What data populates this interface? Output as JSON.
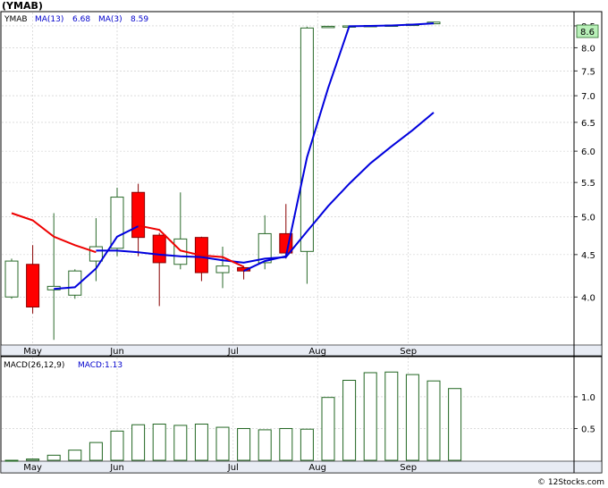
{
  "header": {
    "ticker_label": "(YMAB)",
    "legend": [
      {
        "text": "YMAB",
        "color": "#000000"
      },
      {
        "text": "MA(13)",
        "color": "#0000cc"
      },
      {
        "text": "6.68",
        "color": "#0000cc"
      },
      {
        "text": "MA(3)",
        "color": "#0000cc"
      },
      {
        "text": "8.59",
        "color": "#0000cc"
      }
    ],
    "last_price_badge": "8.6"
  },
  "footer": {
    "watermark": "© 12Stocks.com"
  },
  "colors": {
    "up_candle": "#ffffff",
    "up_border": "#2a6a2a",
    "down_candle": "#ff0000",
    "down_border": "#880000",
    "ma_fast": "#0000dd",
    "ma_slow": "#0000dd",
    "ma_red": "#ee0000",
    "axis_band": "#e8ecf4",
    "badge_bg": "#b8f0b8",
    "macd_bar": "#226622"
  },
  "chart_data": [
    {
      "type": "candlestick",
      "title": "",
      "x_ticks": [
        "May",
        "Jun",
        "Jul",
        "Aug",
        "Sep"
      ],
      "y_ticks": [
        4.0,
        4.5,
        5.0,
        5.5,
        6.0,
        6.5,
        7.0,
        7.5,
        8.0,
        8.5
      ],
      "y_scale": "log",
      "ylim": [
        3.5,
        8.8
      ],
      "candles": [
        {
          "open": 4.0,
          "high": 4.45,
          "low": 3.98,
          "close": 4.42
        },
        {
          "open": 4.38,
          "high": 4.62,
          "low": 3.82,
          "close": 3.89
        },
        {
          "open": 4.08,
          "high": 5.05,
          "low": 3.55,
          "close": 4.12
        },
        {
          "open": 4.02,
          "high": 4.32,
          "low": 3.98,
          "close": 4.3
        },
        {
          "open": 4.42,
          "high": 4.98,
          "low": 4.18,
          "close": 4.6
        },
        {
          "open": 4.58,
          "high": 5.42,
          "low": 4.48,
          "close": 5.28
        },
        {
          "open": 5.35,
          "high": 5.48,
          "low": 4.48,
          "close": 4.72
        },
        {
          "open": 4.75,
          "high": 4.78,
          "low": 3.9,
          "close": 4.4
        },
        {
          "open": 4.38,
          "high": 5.35,
          "low": 4.32,
          "close": 4.7
        },
        {
          "open": 4.72,
          "high": 4.73,
          "low": 4.18,
          "close": 4.28
        },
        {
          "open": 4.28,
          "high": 4.6,
          "low": 4.1,
          "close": 4.36
        },
        {
          "open": 4.34,
          "high": 4.36,
          "low": 4.2,
          "close": 4.3
        },
        {
          "open": 4.4,
          "high": 5.02,
          "low": 4.32,
          "close": 4.77
        },
        {
          "open": 4.77,
          "high": 5.18,
          "low": 4.45,
          "close": 4.52
        },
        {
          "open": 4.54,
          "high": 8.48,
          "low": 4.15,
          "close": 8.45
        },
        {
          "open": 8.48,
          "high": 8.5,
          "low": 8.47,
          "close": 8.49
        },
        {
          "open": 8.49,
          "high": 8.51,
          "low": 8.48,
          "close": 8.5
        },
        {
          "open": 8.5,
          "high": 8.52,
          "low": 8.49,
          "close": 8.51
        },
        {
          "open": 8.51,
          "high": 8.53,
          "low": 8.5,
          "close": 8.52
        },
        {
          "open": 8.53,
          "high": 8.55,
          "low": 8.52,
          "close": 8.54
        },
        {
          "open": 8.55,
          "high": 8.6,
          "low": 8.54,
          "close": 8.59
        }
      ],
      "series": [
        {
          "name": "MA(3)",
          "values": [
            null,
            null,
            4.09,
            4.11,
            4.33,
            4.73,
            4.87,
            null,
            null,
            null,
            null,
            null,
            null,
            null,
            null,
            null,
            null,
            null,
            null,
            null,
            null
          ]
        },
        {
          "name": "MA(3)",
          "values": [
            null,
            null,
            null,
            null,
            null,
            null,
            null,
            null,
            null,
            null,
            null,
            4.3,
            4.42,
            4.48,
            5.9,
            7.15,
            8.49,
            8.5,
            8.51,
            8.53,
            8.56
          ]
        },
        {
          "name": "MA(13)",
          "values": [
            null,
            null,
            null,
            null,
            4.55,
            4.55,
            4.53,
            4.5,
            4.48,
            4.47,
            4.43,
            4.4,
            4.45,
            4.47,
            4.8,
            5.15,
            5.48,
            5.8,
            6.08,
            6.36,
            6.68
          ]
        },
        {
          "name": "",
          "values": [
            5.05,
            4.95,
            4.73,
            4.62,
            4.53,
            null,
            4.88,
            4.82,
            4.55,
            4.49,
            4.47,
            4.35,
            null,
            null,
            null,
            null,
            null,
            null,
            null,
            null,
            null
          ]
        }
      ]
    },
    {
      "type": "bar",
      "title": "MACD(26,12,9)",
      "legend": "MACD:1.13",
      "x_ticks": [
        "May",
        "Jun",
        "Jul",
        "Aug",
        "Sep"
      ],
      "y_ticks": [
        0.5,
        1.0
      ],
      "ylim": [
        0.0,
        1.45
      ],
      "values": [
        0.0,
        0.02,
        0.08,
        0.16,
        0.28,
        0.46,
        0.56,
        0.57,
        0.55,
        0.57,
        0.52,
        0.5,
        0.48,
        0.5,
        0.49,
        0.99,
        1.26,
        1.38,
        1.39,
        1.35,
        1.25,
        1.13
      ]
    }
  ]
}
